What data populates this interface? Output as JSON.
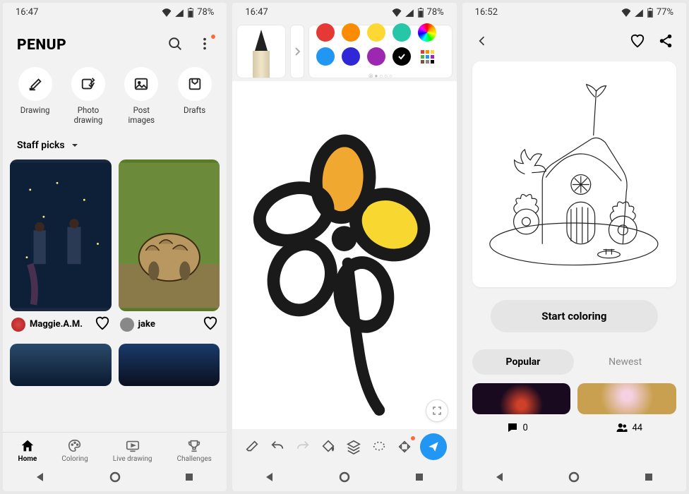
{
  "phone1": {
    "status": {
      "time": "16:47",
      "battery": "78%"
    },
    "title": "PENUP",
    "quick": [
      {
        "label": "Drawing"
      },
      {
        "label": "Photo\ndrawing"
      },
      {
        "label": "Post\nimages"
      },
      {
        "label": "Drafts"
      }
    ],
    "section": "Staff picks",
    "arts": [
      {
        "user": "Maggie.A.M."
      },
      {
        "user": "jake"
      }
    ],
    "nav": [
      {
        "label": "Home",
        "active": true
      },
      {
        "label": "Coloring"
      },
      {
        "label": "Live drawing"
      },
      {
        "label": "Challenges"
      }
    ]
  },
  "phone2": {
    "status": {
      "time": "16:47",
      "battery": "78%"
    },
    "palette": [
      "#e53935",
      "#fb8c00",
      "#fdd835",
      "#26c6a6",
      "rainbow",
      "#2196f3",
      "#3028d6",
      "#9c27b0",
      "#000000",
      "multi"
    ]
  },
  "phone3": {
    "status": {
      "time": "16:52",
      "battery": "77%"
    },
    "button": "Start coloring",
    "tabs": {
      "active": "Popular",
      "other": "Newest"
    },
    "stats": {
      "comments": "0",
      "people": "44"
    }
  }
}
